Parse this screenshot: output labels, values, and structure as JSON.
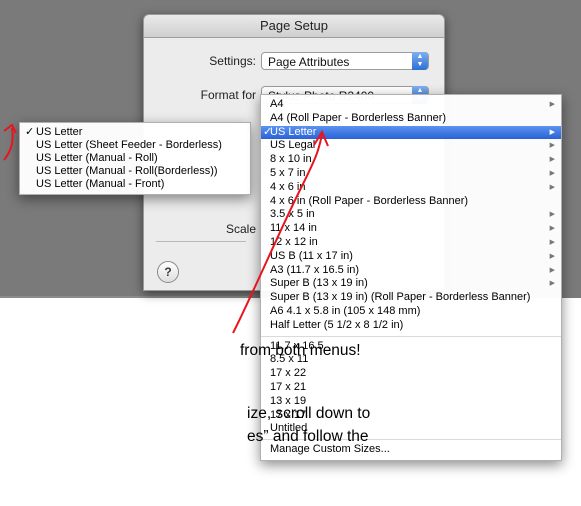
{
  "dialog": {
    "title": "Page Setup",
    "settings_label": "Settings:",
    "settings_value": "Page Attributes",
    "format_label": "Format for",
    "format_value": "Stylus Photo R2400",
    "scale_label": "Scale"
  },
  "left_menu": {
    "items": [
      {
        "label": "US Letter",
        "checked": true
      },
      {
        "label": "US Letter (Sheet Feeder - Borderless)",
        "checked": false
      },
      {
        "label": "US Letter (Manual - Roll)",
        "checked": false
      },
      {
        "label": "US Letter (Manual - Roll(Borderless))",
        "checked": false
      },
      {
        "label": "US Letter (Manual - Front)",
        "checked": false
      }
    ]
  },
  "right_menu": {
    "items": [
      {
        "label": "A4",
        "submenu": true
      },
      {
        "label": "A4 (Roll Paper - Borderless Banner)",
        "submenu": false
      },
      {
        "label": "US Letter",
        "submenu": true,
        "selected": true,
        "checked": true
      },
      {
        "label": "US Legal",
        "submenu": true
      },
      {
        "label": "8 x 10 in",
        "submenu": true
      },
      {
        "label": "5 x 7 in",
        "submenu": true
      },
      {
        "label": "4 x 6 in",
        "submenu": true
      },
      {
        "label": "4 x 6 in (Roll Paper - Borderless Banner)",
        "submenu": false
      },
      {
        "label": "3.5 x 5 in",
        "submenu": true
      },
      {
        "label": "11 x 14 in",
        "submenu": true
      },
      {
        "label": "12 x 12 in",
        "submenu": true
      },
      {
        "label": "US B (11 x 17 in)",
        "submenu": true
      },
      {
        "label": "A3 (11.7 x 16.5 in)",
        "submenu": true
      },
      {
        "label": "Super B (13 x 19 in)",
        "submenu": true
      },
      {
        "label": "Super B (13 x 19 in) (Roll Paper - Borderless Banner)",
        "submenu": false
      },
      {
        "label": "A6 4.1 x 5.8 in (105 x 148 mm)",
        "submenu": false
      },
      {
        "label": "Half Letter (5 1/2 x 8 1/2 in)",
        "submenu": false
      }
    ],
    "custom_items": [
      "11.7 x 16.5",
      "8.5 x 11",
      "17 x 22",
      "17 x 21",
      "13 x 19",
      "17 x 17",
      "Untitled"
    ],
    "manage_label": "Manage Custom Sizes..."
  },
  "annotations": {
    "line1": "from both menus!",
    "line2": "ize, scroll down to",
    "line3": "es” and follow the"
  },
  "colors": {
    "selection": "#2a62d6",
    "annotation_arrow": "#e8141e"
  },
  "icons": {
    "help": "?"
  }
}
